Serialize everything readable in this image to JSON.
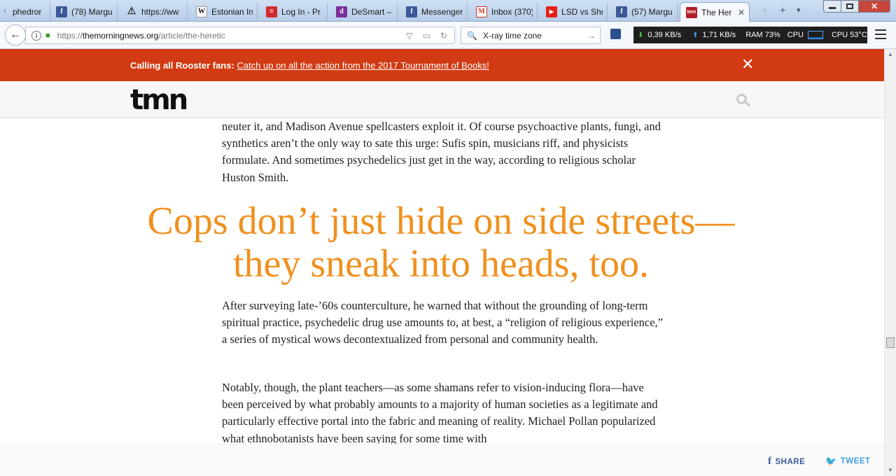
{
  "tabs": [
    {
      "label": "phedror",
      "icon": "partial-tab-icon",
      "color": "#c7d6ea"
    },
    {
      "label": "(78) Margu",
      "icon": "facebook-icon",
      "color": "#3b5998"
    },
    {
      "label": "https://ww",
      "icon": "warning-icon",
      "color": "#f5c400"
    },
    {
      "label": "Estonian In",
      "icon": "wikipedia-icon",
      "color": "#ffffff"
    },
    {
      "label": "Log In - Pr",
      "icon": "login-site-icon",
      "color": "#d12b2b"
    },
    {
      "label": "DeSmart –",
      "icon": "desmart-icon",
      "color": "#7a2f9a"
    },
    {
      "label": "Messenger",
      "icon": "facebook-icon",
      "color": "#3b5998"
    },
    {
      "label": "Inbox (370)",
      "icon": "gmail-icon",
      "color": "#d93025"
    },
    {
      "label": "LSD vs Shr",
      "icon": "youtube-icon",
      "color": "#e62117"
    },
    {
      "label": "(57) Margu",
      "icon": "facebook-icon",
      "color": "#3b5998"
    }
  ],
  "active_tab": {
    "label": "The Her",
    "icon": "tmn-favicon-icon",
    "icon_text": "tmn",
    "color": "#b41e2a",
    "close": "✕"
  },
  "tab_buttons": {
    "scroll_left": "‹",
    "scroll_right": "›",
    "new_tab": "+",
    "list_all": "▾"
  },
  "nav": {
    "back": "←",
    "url_prefix": "https://",
    "url_domain": "themorningnews.org",
    "url_path": "/article/the-heretic",
    "search_value": "X-ray time zone"
  },
  "stats": {
    "down": "0,39 KB/s",
    "up": "1,71 KB/s",
    "ram": "RAM 73%",
    "cpu_label": "CPU",
    "cpu_temp": "CPU 53°C"
  },
  "banner": {
    "lead": "Calling all Rooster fans:",
    "link": "Catch up on all the action from the 2017 Tournament of Books!",
    "close": "✕"
  },
  "site": {
    "logo": "tmn"
  },
  "article": {
    "para1": "neuter it, and Madison Avenue spellcasters exploit it. Of course psychoactive plants, fungi, and synthetics aren’t the only way to sate this urge: Sufis spin, musicians riff, and physicists formulate. And sometimes psychedelics just get in the way, according to religious scholar Huston Smith.",
    "pull_quote": "Cops don’t just hide on side streets—they sneak into heads, too.",
    "para2": "After surveying late-’60s counterculture, he warned that without the grounding of long-term spiritual practice, psychedelic drug use amounts to, at best, a “religion of religious experience,” a series of mystical wows decontextualized from personal and community health.",
    "para3": "Notably, though, the plant teachers—as some shamans refer to vision-inducing flora—have been perceived by what probably amounts to a majority of human societies as a legitimate and particularly effective portal into the fabric and meaning of reality. Michael Pollan popularized what ethnobotanists have been saying for some time with"
  },
  "share": {
    "facebook": "SHARE",
    "twitter": "TWEET",
    "facebook_glyph": "f",
    "twitter_glyph": "🐦"
  },
  "colors": {
    "banner": "#d13a12",
    "pull_quote": "#f0901e",
    "facebook": "#3b5a9a",
    "twitter": "#3d9ee0"
  }
}
